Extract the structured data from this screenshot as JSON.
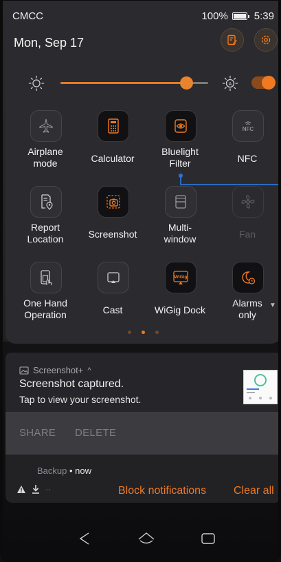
{
  "status_bar": {
    "carrier": "CMCC",
    "battery": "100%",
    "time": "5:39"
  },
  "header": {
    "date": "Mon, Sep 17",
    "edit_icon": "edit-icon",
    "settings_icon": "gear-icon"
  },
  "brightness": {
    "level": 0.85,
    "auto_toggle_on": true,
    "accent": "#ef7a22"
  },
  "tiles": [
    {
      "label": "Airplane\nmode",
      "icon": "airplane-icon",
      "on": false
    },
    {
      "label": "Calculator",
      "icon": "calculator-icon",
      "on": true
    },
    {
      "label": "Bluelight\nFilter",
      "icon": "eye-icon",
      "on": true
    },
    {
      "label": "NFC",
      "icon": "nfc-icon",
      "on": false
    },
    {
      "label": "Report\nLocation",
      "icon": "report-location-icon",
      "on": false
    },
    {
      "label": "Screenshot",
      "icon": "screenshot-icon",
      "on": true
    },
    {
      "label": "Multi-\nwindow",
      "icon": "multi-window-icon",
      "on": false
    },
    {
      "label": "Fan",
      "icon": "fan-icon",
      "on": false,
      "disabled": true
    },
    {
      "label": "One Hand\nOperation",
      "icon": "one-hand-icon",
      "on": false
    },
    {
      "label": "Cast",
      "icon": "cast-icon",
      "on": false
    },
    {
      "label": "WiGig Dock",
      "icon": "wigig-icon",
      "on": true
    },
    {
      "label": "Alarms\nonly",
      "icon": "alarm-icon",
      "on": true
    }
  ],
  "wigig_text": "WiGig",
  "page_dots": 3,
  "page_active": 1,
  "notification": {
    "app": "Screenshot+",
    "title": "Screenshot captured.",
    "text": "Tap to view your screenshot.",
    "actions": {
      "share": "SHARE",
      "delete": "DELETE"
    }
  },
  "backup": {
    "app": "Backup",
    "time": "now",
    "block_label": "Block notifications",
    "clear_label": "Clear all"
  }
}
